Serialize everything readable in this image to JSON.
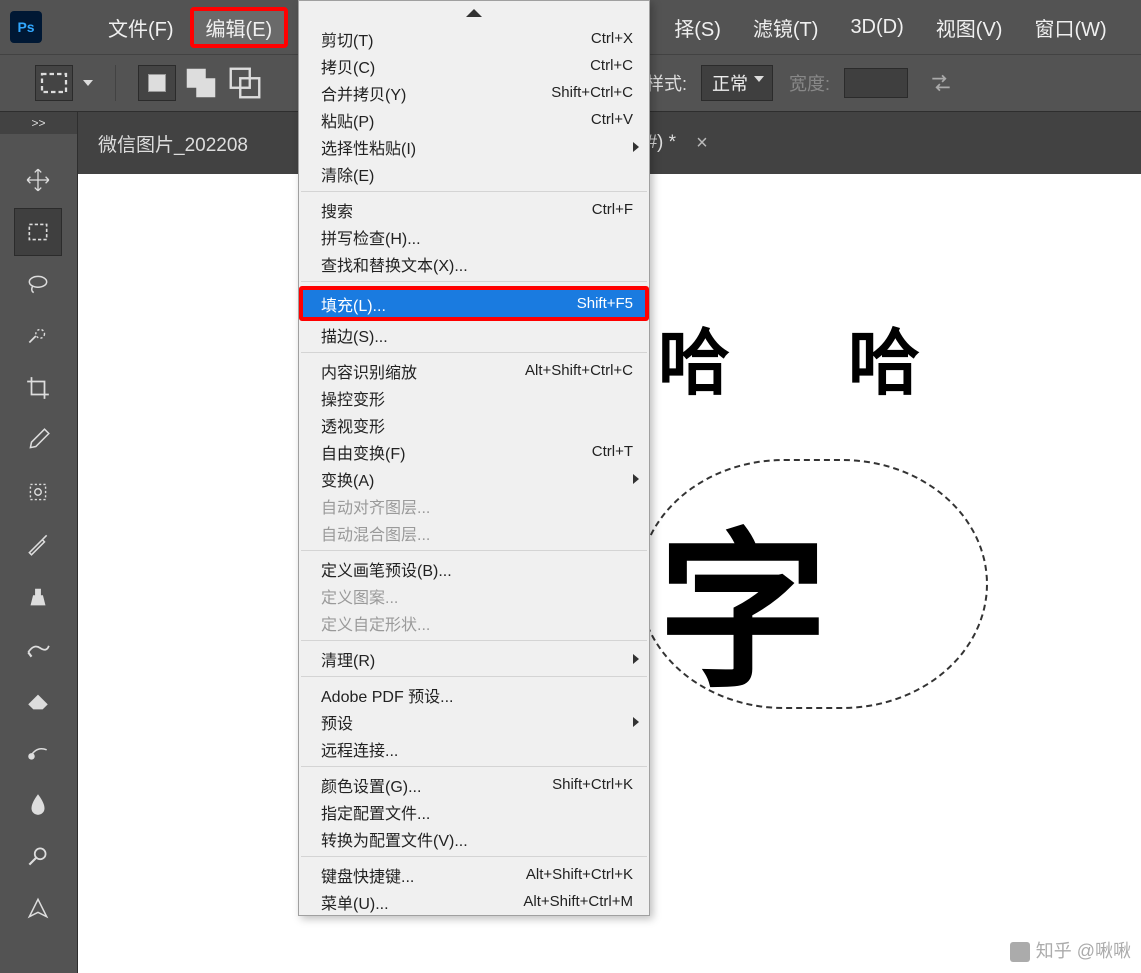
{
  "app_icon_text": "Ps",
  "menubar": {
    "file": "文件(F)",
    "edit": "编辑(E)",
    "select_partial": "择(S)",
    "filter": "滤镜(T)",
    "threeD": "3D(D)",
    "view": "视图(V)",
    "window": "窗口(W)"
  },
  "optionbar": {
    "style_label": "样式:",
    "style_value": "正常",
    "width_label": "宽度:"
  },
  "tabbar": {
    "filename_visible_left": "微信图片_202208",
    "filename_visible_right": "B/8#) *",
    "close": "×"
  },
  "canvas_text": {
    "ha1": "哈",
    "ha2": "哈",
    "main": "字"
  },
  "dropdown": {
    "items": [
      {
        "label": "剪切(T)",
        "shortcut": "Ctrl+X"
      },
      {
        "label": "拷贝(C)",
        "shortcut": "Ctrl+C"
      },
      {
        "label": "合并拷贝(Y)",
        "shortcut": "Shift+Ctrl+C"
      },
      {
        "label": "粘贴(P)",
        "shortcut": "Ctrl+V"
      },
      {
        "label": "选择性粘贴(I)",
        "submenu": true
      },
      {
        "label": "清除(E)"
      },
      {
        "sep": true
      },
      {
        "label": "搜索",
        "shortcut": "Ctrl+F"
      },
      {
        "label": "拼写检查(H)..."
      },
      {
        "label": "查找和替换文本(X)..."
      },
      {
        "sep": true
      },
      {
        "label": "填充(L)...",
        "shortcut": "Shift+F5",
        "selected": true,
        "fill_highlight": true
      },
      {
        "label": "描边(S)..."
      },
      {
        "sep": true
      },
      {
        "label": "内容识别缩放",
        "shortcut": "Alt+Shift+Ctrl+C"
      },
      {
        "label": "操控变形"
      },
      {
        "label": "透视变形"
      },
      {
        "label": "自由变换(F)",
        "shortcut": "Ctrl+T"
      },
      {
        "label": "变换(A)",
        "submenu": true
      },
      {
        "label": "自动对齐图层...",
        "disabled": true
      },
      {
        "label": "自动混合图层...",
        "disabled": true
      },
      {
        "sep": true
      },
      {
        "label": "定义画笔预设(B)..."
      },
      {
        "label": "定义图案...",
        "disabled": true
      },
      {
        "label": "定义自定形状...",
        "disabled": true
      },
      {
        "sep": true
      },
      {
        "label": "清理(R)",
        "submenu": true
      },
      {
        "sep": true
      },
      {
        "label": "Adobe PDF 预设..."
      },
      {
        "label": "预设",
        "submenu": true
      },
      {
        "label": "远程连接..."
      },
      {
        "sep": true
      },
      {
        "label": "颜色设置(G)...",
        "shortcut": "Shift+Ctrl+K"
      },
      {
        "label": "指定配置文件..."
      },
      {
        "label": "转换为配置文件(V)..."
      },
      {
        "sep": true
      },
      {
        "label": "键盘快捷键...",
        "shortcut": "Alt+Shift+Ctrl+K"
      },
      {
        "label": "菜单(U)...",
        "shortcut": "Alt+Shift+Ctrl+M"
      }
    ]
  },
  "sidebar_expand": ">>",
  "watermark": "知乎 @啾啾"
}
